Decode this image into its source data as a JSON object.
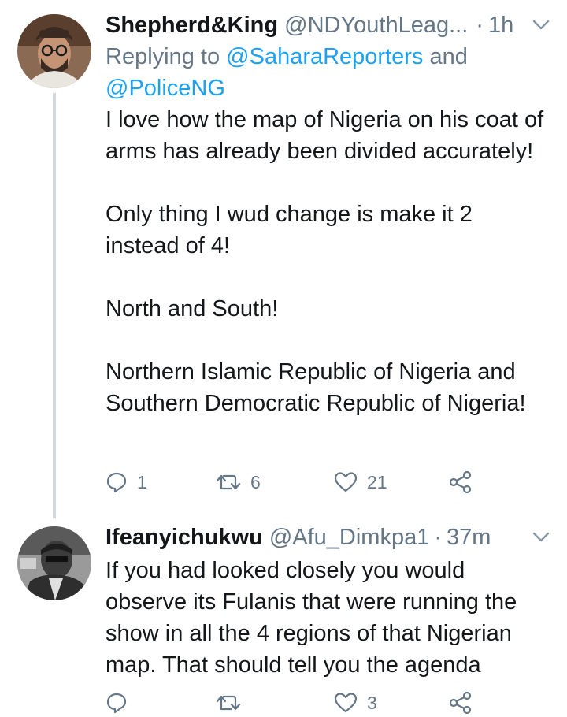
{
  "tweets": [
    {
      "display_name": "Shepherd&King",
      "handle": "@NDYouthLeag...",
      "separator": "·",
      "time": "1h",
      "replying_prefix": "Replying to ",
      "replying_to_1": "@SaharaReporters",
      "replying_and": " and",
      "replying_to_2": "@PoliceNG",
      "paragraphs": [
        "I love how the map of Nigeria on his coat of arms has already been divided accurately!",
        "Only thing I wud change is make it 2 instead of 4!",
        "North and South!",
        "Northern Islamic Republic of Nigeria and Southern Democratic Republic of Nigeria!"
      ],
      "reply_count": "1",
      "retweet_count": "6",
      "like_count": "21",
      "avatar_icon": "person-with-glasses-avatar"
    },
    {
      "display_name": "Ifeanyichukwu",
      "handle": "@Afu_Dimkpa1",
      "separator": "·",
      "time": "37m",
      "text_lines": [
        "If you had looked closely you would",
        "observe its Fulanis that were running the",
        "show in all the 4 regions of that Nigerian",
        "map. That should tell you the agenda"
      ],
      "reply_count": "",
      "retweet_count": "",
      "like_count": "3",
      "avatar_icon": "grayscale-person-avatar"
    }
  ],
  "icons": {
    "reply": "reply-icon",
    "retweet": "retweet-icon",
    "like": "heart-icon",
    "share": "share-icon",
    "more": "chevron-down-icon"
  },
  "colors": {
    "text": "#14171a",
    "secondary": "#657786",
    "link": "#1da1f2",
    "thread_line": "#cfd9de"
  }
}
